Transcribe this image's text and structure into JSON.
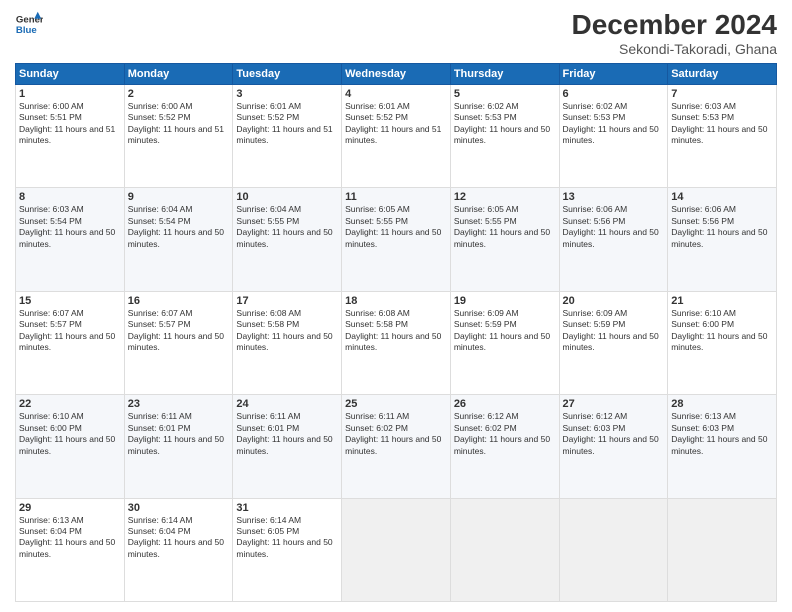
{
  "logo": {
    "line1": "General",
    "line2": "Blue"
  },
  "title": "December 2024",
  "subtitle": "Sekondi-Takoradi, Ghana",
  "days_header": [
    "Sunday",
    "Monday",
    "Tuesday",
    "Wednesday",
    "Thursday",
    "Friday",
    "Saturday"
  ],
  "weeks": [
    [
      {
        "day": "1",
        "sunrise": "Sunrise: 6:00 AM",
        "sunset": "Sunset: 5:51 PM",
        "daylight": "Daylight: 11 hours and 51 minutes."
      },
      {
        "day": "2",
        "sunrise": "Sunrise: 6:00 AM",
        "sunset": "Sunset: 5:52 PM",
        "daylight": "Daylight: 11 hours and 51 minutes."
      },
      {
        "day": "3",
        "sunrise": "Sunrise: 6:01 AM",
        "sunset": "Sunset: 5:52 PM",
        "daylight": "Daylight: 11 hours and 51 minutes."
      },
      {
        "day": "4",
        "sunrise": "Sunrise: 6:01 AM",
        "sunset": "Sunset: 5:52 PM",
        "daylight": "Daylight: 11 hours and 51 minutes."
      },
      {
        "day": "5",
        "sunrise": "Sunrise: 6:02 AM",
        "sunset": "Sunset: 5:53 PM",
        "daylight": "Daylight: 11 hours and 50 minutes."
      },
      {
        "day": "6",
        "sunrise": "Sunrise: 6:02 AM",
        "sunset": "Sunset: 5:53 PM",
        "daylight": "Daylight: 11 hours and 50 minutes."
      },
      {
        "day": "7",
        "sunrise": "Sunrise: 6:03 AM",
        "sunset": "Sunset: 5:53 PM",
        "daylight": "Daylight: 11 hours and 50 minutes."
      }
    ],
    [
      {
        "day": "8",
        "sunrise": "Sunrise: 6:03 AM",
        "sunset": "Sunset: 5:54 PM",
        "daylight": "Daylight: 11 hours and 50 minutes."
      },
      {
        "day": "9",
        "sunrise": "Sunrise: 6:04 AM",
        "sunset": "Sunset: 5:54 PM",
        "daylight": "Daylight: 11 hours and 50 minutes."
      },
      {
        "day": "10",
        "sunrise": "Sunrise: 6:04 AM",
        "sunset": "Sunset: 5:55 PM",
        "daylight": "Daylight: 11 hours and 50 minutes."
      },
      {
        "day": "11",
        "sunrise": "Sunrise: 6:05 AM",
        "sunset": "Sunset: 5:55 PM",
        "daylight": "Daylight: 11 hours and 50 minutes."
      },
      {
        "day": "12",
        "sunrise": "Sunrise: 6:05 AM",
        "sunset": "Sunset: 5:55 PM",
        "daylight": "Daylight: 11 hours and 50 minutes."
      },
      {
        "day": "13",
        "sunrise": "Sunrise: 6:06 AM",
        "sunset": "Sunset: 5:56 PM",
        "daylight": "Daylight: 11 hours and 50 minutes."
      },
      {
        "day": "14",
        "sunrise": "Sunrise: 6:06 AM",
        "sunset": "Sunset: 5:56 PM",
        "daylight": "Daylight: 11 hours and 50 minutes."
      }
    ],
    [
      {
        "day": "15",
        "sunrise": "Sunrise: 6:07 AM",
        "sunset": "Sunset: 5:57 PM",
        "daylight": "Daylight: 11 hours and 50 minutes."
      },
      {
        "day": "16",
        "sunrise": "Sunrise: 6:07 AM",
        "sunset": "Sunset: 5:57 PM",
        "daylight": "Daylight: 11 hours and 50 minutes."
      },
      {
        "day": "17",
        "sunrise": "Sunrise: 6:08 AM",
        "sunset": "Sunset: 5:58 PM",
        "daylight": "Daylight: 11 hours and 50 minutes."
      },
      {
        "day": "18",
        "sunrise": "Sunrise: 6:08 AM",
        "sunset": "Sunset: 5:58 PM",
        "daylight": "Daylight: 11 hours and 50 minutes."
      },
      {
        "day": "19",
        "sunrise": "Sunrise: 6:09 AM",
        "sunset": "Sunset: 5:59 PM",
        "daylight": "Daylight: 11 hours and 50 minutes."
      },
      {
        "day": "20",
        "sunrise": "Sunrise: 6:09 AM",
        "sunset": "Sunset: 5:59 PM",
        "daylight": "Daylight: 11 hours and 50 minutes."
      },
      {
        "day": "21",
        "sunrise": "Sunrise: 6:10 AM",
        "sunset": "Sunset: 6:00 PM",
        "daylight": "Daylight: 11 hours and 50 minutes."
      }
    ],
    [
      {
        "day": "22",
        "sunrise": "Sunrise: 6:10 AM",
        "sunset": "Sunset: 6:00 PM",
        "daylight": "Daylight: 11 hours and 50 minutes."
      },
      {
        "day": "23",
        "sunrise": "Sunrise: 6:11 AM",
        "sunset": "Sunset: 6:01 PM",
        "daylight": "Daylight: 11 hours and 50 minutes."
      },
      {
        "day": "24",
        "sunrise": "Sunrise: 6:11 AM",
        "sunset": "Sunset: 6:01 PM",
        "daylight": "Daylight: 11 hours and 50 minutes."
      },
      {
        "day": "25",
        "sunrise": "Sunrise: 6:11 AM",
        "sunset": "Sunset: 6:02 PM",
        "daylight": "Daylight: 11 hours and 50 minutes."
      },
      {
        "day": "26",
        "sunrise": "Sunrise: 6:12 AM",
        "sunset": "Sunset: 6:02 PM",
        "daylight": "Daylight: 11 hours and 50 minutes."
      },
      {
        "day": "27",
        "sunrise": "Sunrise: 6:12 AM",
        "sunset": "Sunset: 6:03 PM",
        "daylight": "Daylight: 11 hours and 50 minutes."
      },
      {
        "day": "28",
        "sunrise": "Sunrise: 6:13 AM",
        "sunset": "Sunset: 6:03 PM",
        "daylight": "Daylight: 11 hours and 50 minutes."
      }
    ],
    [
      {
        "day": "29",
        "sunrise": "Sunrise: 6:13 AM",
        "sunset": "Sunset: 6:04 PM",
        "daylight": "Daylight: 11 hours and 50 minutes."
      },
      {
        "day": "30",
        "sunrise": "Sunrise: 6:14 AM",
        "sunset": "Sunset: 6:04 PM",
        "daylight": "Daylight: 11 hours and 50 minutes."
      },
      {
        "day": "31",
        "sunrise": "Sunrise: 6:14 AM",
        "sunset": "Sunset: 6:05 PM",
        "daylight": "Daylight: 11 hours and 50 minutes."
      },
      null,
      null,
      null,
      null
    ]
  ]
}
